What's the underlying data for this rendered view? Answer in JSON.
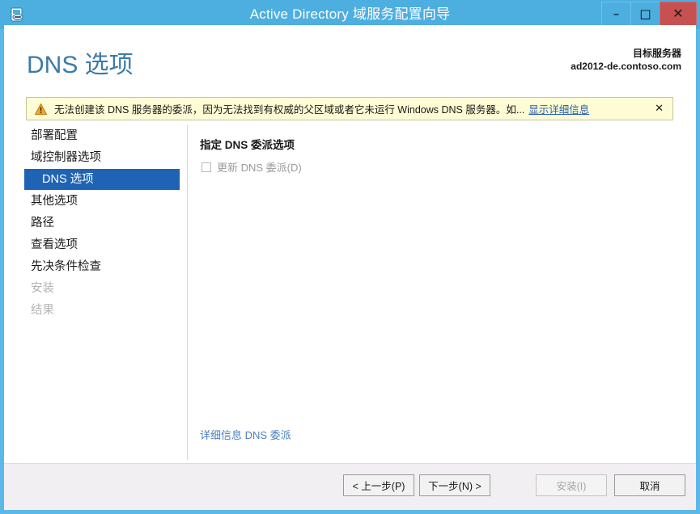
{
  "window": {
    "title": "Active Directory 域服务配置向导",
    "icon": "wizard-server-icon",
    "controls": {
      "minimize": "–",
      "maximize": "□",
      "close": "✕"
    }
  },
  "header": {
    "page_title": "DNS 选项",
    "target_server_label": "目标服务器",
    "target_server_name": "ad2012-de.contoso.com",
    "title_color": "#3b7ba8"
  },
  "warning": {
    "icon": "warning-triangle-icon",
    "message": "无法创建该 DNS 服务器的委派，因为无法找到有权威的父区域或者它未运行 Windows DNS 服务器。如...",
    "details_link": "显示详细信息",
    "close_glyph": "✕",
    "background": "#fdfcd4",
    "border": "#c8c49a"
  },
  "sidebar": {
    "items": [
      {
        "label": "部署配置",
        "selected": false,
        "disabled": false
      },
      {
        "label": "域控制器选项",
        "selected": false,
        "disabled": false
      },
      {
        "label": "DNS 选项",
        "selected": true,
        "disabled": false
      },
      {
        "label": "其他选项",
        "selected": false,
        "disabled": false
      },
      {
        "label": "路径",
        "selected": false,
        "disabled": false
      },
      {
        "label": "查看选项",
        "selected": false,
        "disabled": false
      },
      {
        "label": "先决条件检查",
        "selected": false,
        "disabled": false
      },
      {
        "label": "安装",
        "selected": false,
        "disabled": true
      },
      {
        "label": "结果",
        "selected": false,
        "disabled": true
      }
    ],
    "selected_color": "#1f63b4"
  },
  "content": {
    "heading": "指定 DNS 委派选项",
    "checkbox_label": "更新 DNS 委派(D)",
    "checkbox_checked": false,
    "more_link": "详细信息 DNS 委派",
    "link_color": "#4a7fc1"
  },
  "footer": {
    "previous": "< 上一步(P)",
    "next": "下一步(N) >",
    "install": "安装(I)",
    "install_disabled": true,
    "cancel": "取消"
  }
}
